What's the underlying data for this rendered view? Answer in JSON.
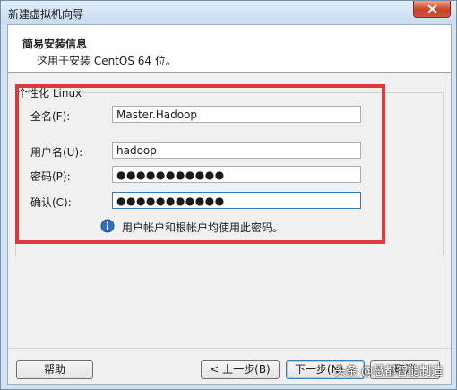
{
  "window": {
    "title": "新建虚拟机向导"
  },
  "header": {
    "title": "简易安装信息",
    "subtitle": "这用于安装 CentOS 64 位。"
  },
  "group": {
    "label": "个性化 Linux"
  },
  "fields": {
    "fullname_label": "全名(F):",
    "fullname_value": "Master.Hadoop",
    "username_label": "用户名(U):",
    "username_value": "hadoop",
    "password_label": "密码(P):",
    "password_value": "●●●●●●●●●●●",
    "confirm_label": "确认(C):",
    "confirm_value": "●●●●●●●●●●●"
  },
  "info": {
    "text": "用户帐户和根帐户均使用此密码。",
    "icon": "info-icon"
  },
  "buttons": {
    "help": "帮助",
    "back": "< 上一步(B)",
    "next": "下一步(N) >",
    "cancel": "取消"
  },
  "watermark": {
    "text": "头条 @慧都智能制造"
  },
  "colors": {
    "annotation_frame": "#e0393c",
    "close_button": "#c7432a",
    "window_frame": "#cfe3f5"
  }
}
